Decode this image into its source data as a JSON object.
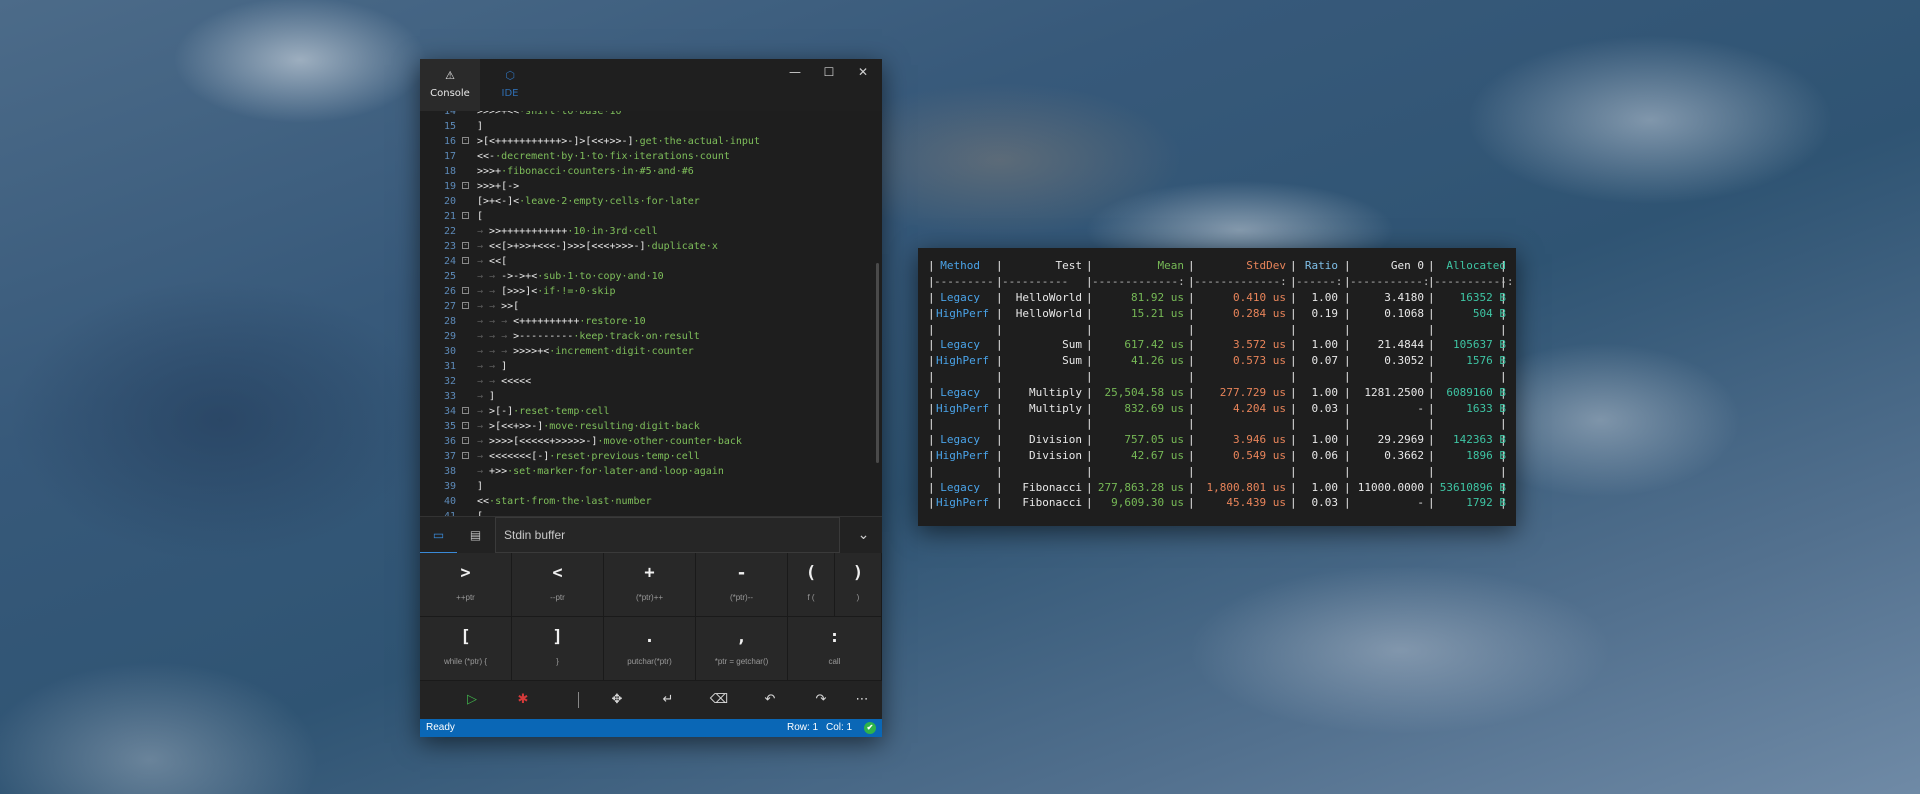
{
  "ide": {
    "tabs": [
      {
        "label": "Console",
        "icon": "warning-triangle-icon"
      },
      {
        "label": "IDE",
        "icon": "cube-icon"
      }
    ],
    "window_controls": {
      "minimize": "—",
      "maximize": "☐",
      "close": "✕"
    },
    "editor_lines": [
      {
        "n": "14",
        "code": ">>>>+<< shift to base 10",
        "partial": true
      },
      {
        "n": "15",
        "code": "]"
      },
      {
        "n": "16",
        "code": ">[<+++++++++++>-]>[<<+>>-] get the actual input",
        "fold": true
      },
      {
        "n": "17",
        "code": "<<- decrement by 1 to fix iterations count"
      },
      {
        "n": "18",
        "code": ">>>+ fibonacci counters in #5 and #6"
      },
      {
        "n": "19",
        "code": ">>>+[->",
        "fold": true
      },
      {
        "n": "20",
        "code": "[>+<-]< leave 2 empty cells for later"
      },
      {
        "n": "21",
        "code": "[",
        "fold": true
      },
      {
        "n": "22",
        "code": "  >>+++++++++++ 10 in 3rd cell"
      },
      {
        "n": "23",
        "code": "  <<[>+>>+<<<-]>>>[<<<+>>>-] duplicate x",
        "fold": true
      },
      {
        "n": "24",
        "code": "  <<[",
        "fold": true
      },
      {
        "n": "25",
        "code": "    ->->+< sub 1 to copy and 10"
      },
      {
        "n": "26",
        "code": "    [>>>]< if != 0 skip",
        "fold": true
      },
      {
        "n": "27",
        "code": "    >>[",
        "fold": true
      },
      {
        "n": "28",
        "code": "      <++++++++++ restore 10"
      },
      {
        "n": "29",
        "code": "      >--------- keep track on result"
      },
      {
        "n": "30",
        "code": "      >>>>+< increment digit counter"
      },
      {
        "n": "31",
        "code": "    ]"
      },
      {
        "n": "32",
        "code": "    <<<<<"
      },
      {
        "n": "33",
        "code": "  ]"
      },
      {
        "n": "34",
        "code": "  >[-] reset temp cell",
        "fold": true
      },
      {
        "n": "35",
        "code": "  >[<<+>>-] move resulting digit back",
        "fold": true
      },
      {
        "n": "36",
        "code": "  >>>>[<<<<<+>>>>>-] move other counter back",
        "fold": true
      },
      {
        "n": "37",
        "code": "  <<<<<<<[-] reset previous temp cell",
        "fold": true
      },
      {
        "n": "38",
        "code": "  +>> set marker for later and loop again"
      },
      {
        "n": "39",
        "code": "]"
      },
      {
        "n": "40",
        "code": "<< start from the last number"
      },
      {
        "n": "41",
        "code": "[",
        "partial": true
      }
    ],
    "stdin": {
      "placeholder": "Stdin buffer",
      "expand_icon": "chevron-down-icon"
    },
    "keys": [
      {
        "sym": ">",
        "label": "++ptr"
      },
      {
        "sym": "<",
        "label": "--ptr"
      },
      {
        "sym": "+",
        "label": "(*ptr)++"
      },
      {
        "sym": "-",
        "label": "(*ptr)--"
      },
      {
        "sym": "(",
        "label": "f ("
      },
      {
        "sym": ")",
        "label": ")"
      },
      {
        "sym": "[",
        "label": "while (*ptr) {"
      },
      {
        "sym": "]",
        "label": "}"
      },
      {
        "sym": ".",
        "label": "putchar(*ptr)"
      },
      {
        "sym": ",",
        "label": "*ptr = getchar()"
      },
      {
        "sym": ":",
        "label": "call"
      }
    ],
    "toolbar": [
      {
        "name": "run-icon",
        "glyph": "▷"
      },
      {
        "name": "debug-icon",
        "glyph": "✱"
      },
      {
        "name": "move-icon",
        "glyph": "✥"
      },
      {
        "name": "enter-icon",
        "glyph": "↵"
      },
      {
        "name": "backspace-icon",
        "glyph": "⌫"
      },
      {
        "name": "undo-icon",
        "glyph": "↶"
      },
      {
        "name": "redo-icon",
        "glyph": "↷"
      },
      {
        "name": "more-icon",
        "glyph": "⋯"
      }
    ],
    "status": {
      "state": "Ready",
      "row": "Row: 1",
      "col": "Col: 1",
      "ok_icon": "✔"
    }
  },
  "benchmark": {
    "header": [
      "Method",
      "Test",
      "Mean",
      "StdDev",
      "Ratio",
      "Gen 0",
      "Allocated"
    ],
    "separator": [
      "---------",
      "----------",
      "-------------:",
      "-------------:",
      "------:",
      "-----------:",
      "-----------:"
    ],
    "rows": [
      [
        "Legacy",
        "HelloWorld",
        "81.92 us",
        "0.410 us",
        "1.00",
        "3.4180",
        "16352 B"
      ],
      [
        "HighPerf",
        "HelloWorld",
        "15.21 us",
        "0.284 us",
        "0.19",
        "0.1068",
        "504 B"
      ],
      [
        "",
        "",
        "",
        "",
        "",
        "",
        ""
      ],
      [
        "Legacy",
        "Sum",
        "617.42 us",
        "3.572 us",
        "1.00",
        "21.4844",
        "105637 B"
      ],
      [
        "HighPerf",
        "Sum",
        "41.26 us",
        "0.573 us",
        "0.07",
        "0.3052",
        "1576 B"
      ],
      [
        "",
        "",
        "",
        "",
        "",
        "",
        ""
      ],
      [
        "Legacy",
        "Multiply",
        "25,504.58 us",
        "277.729 us",
        "1.00",
        "1281.2500",
        "6089160 B"
      ],
      [
        "HighPerf",
        "Multiply",
        "832.69 us",
        "4.204 us",
        "0.03",
        "-",
        "1633 B"
      ],
      [
        "",
        "",
        "",
        "",
        "",
        "",
        ""
      ],
      [
        "Legacy",
        "Division",
        "757.05 us",
        "3.946 us",
        "1.00",
        "29.2969",
        "142363 B"
      ],
      [
        "HighPerf",
        "Division",
        "42.67 us",
        "0.549 us",
        "0.06",
        "0.3662",
        "1896 B"
      ],
      [
        "",
        "",
        "",
        "",
        "",
        "",
        ""
      ],
      [
        "Legacy",
        "Fibonacci",
        "277,863.28 us",
        "1,800.801 us",
        "1.00",
        "11000.0000",
        "53610896 B"
      ],
      [
        "HighPerf",
        "Fibonacci",
        "9,609.30 us",
        "45.439 us",
        "0.03",
        "-",
        "1792 B"
      ]
    ]
  }
}
